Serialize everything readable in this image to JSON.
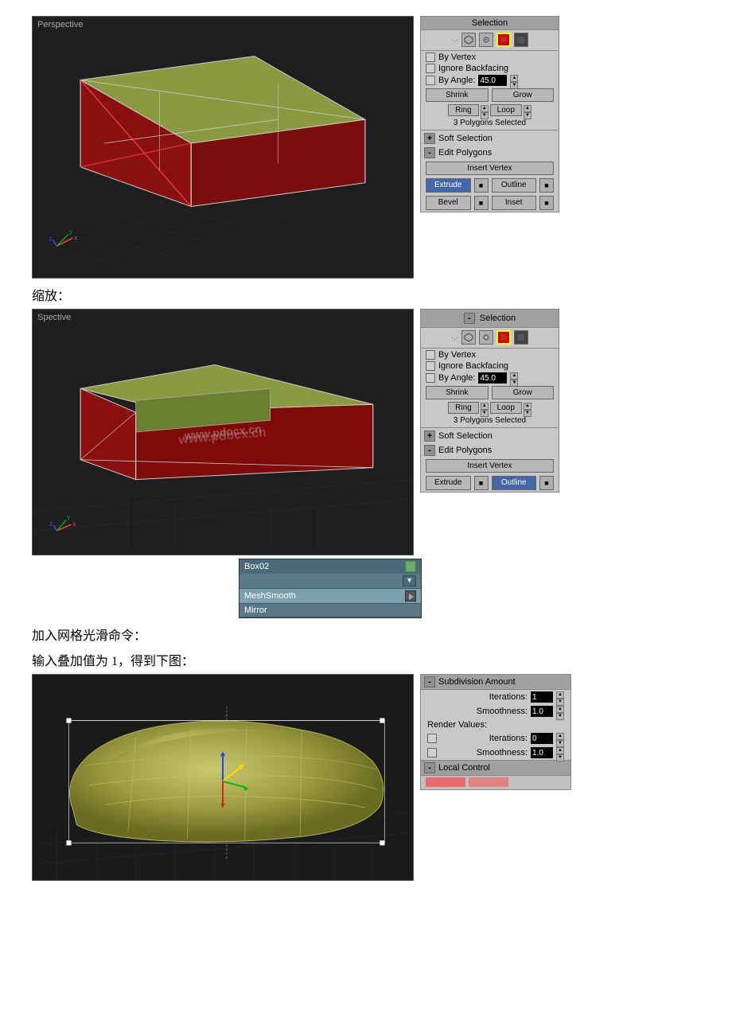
{
  "viewport1": {
    "label": "Perspective",
    "watermark": ""
  },
  "viewport2": {
    "label": "Spective",
    "watermark": "www.pdocx.cn"
  },
  "viewport3": {
    "label": ""
  },
  "panel1": {
    "header": "Selection",
    "by_vertex": "By Vertex",
    "ignore_backfacing": "Ignore Backfacing",
    "by_angle_label": "By Angle:",
    "by_angle_value": "45.0",
    "shrink": "Shrink",
    "grow": "Grow",
    "ring": "Ring",
    "loop": "Loop",
    "selected_text": "3 Polygons Selected",
    "soft_selection_label": "Soft Selection",
    "edit_polygons_label": "Edit Polygons",
    "insert_vertex": "Insert Vertex",
    "extrude": "Extrude",
    "outline": "Outline",
    "bevel": "Bevel",
    "inset": "Inset"
  },
  "panel2": {
    "header": "Selection",
    "by_vertex": "By Vertex",
    "ignore_backfacing": "Ignore Backfacing",
    "by_angle_label": "By Angle:",
    "by_angle_value": "45.0",
    "shrink": "Shrink",
    "grow": "Grow",
    "ring": "Ring",
    "loop": "Loop",
    "selected_text": "3 Polygons Selected",
    "soft_selection_label": "Soft Selection",
    "edit_polygons_label": "Edit Polygons",
    "insert_vertex": "Insert Vertex",
    "extrude": "Extrude",
    "outline": "Outline"
  },
  "label_scale": "缩放：",
  "label_add_smooth": "加入网格光滑命令：",
  "label_input_value": "输入叠加值为 1，得到下图：",
  "mod_stack": {
    "box_name": "Box02",
    "mesh_smooth": "MeshSmooth",
    "mirror": "Mirror"
  },
  "subdiv_panel": {
    "header": "Subdivision Amount",
    "iterations_label": "Iterations:",
    "iterations_value": "1",
    "smoothness_label": "Smoothness:",
    "smoothness_value": "1.0",
    "render_values": "Render Values:",
    "render_iterations_label": "Iterations:",
    "render_iterations_value": "0",
    "render_smoothness_label": "Smoothness:",
    "render_smoothness_value": "1.0",
    "local_control": "Local Control"
  }
}
